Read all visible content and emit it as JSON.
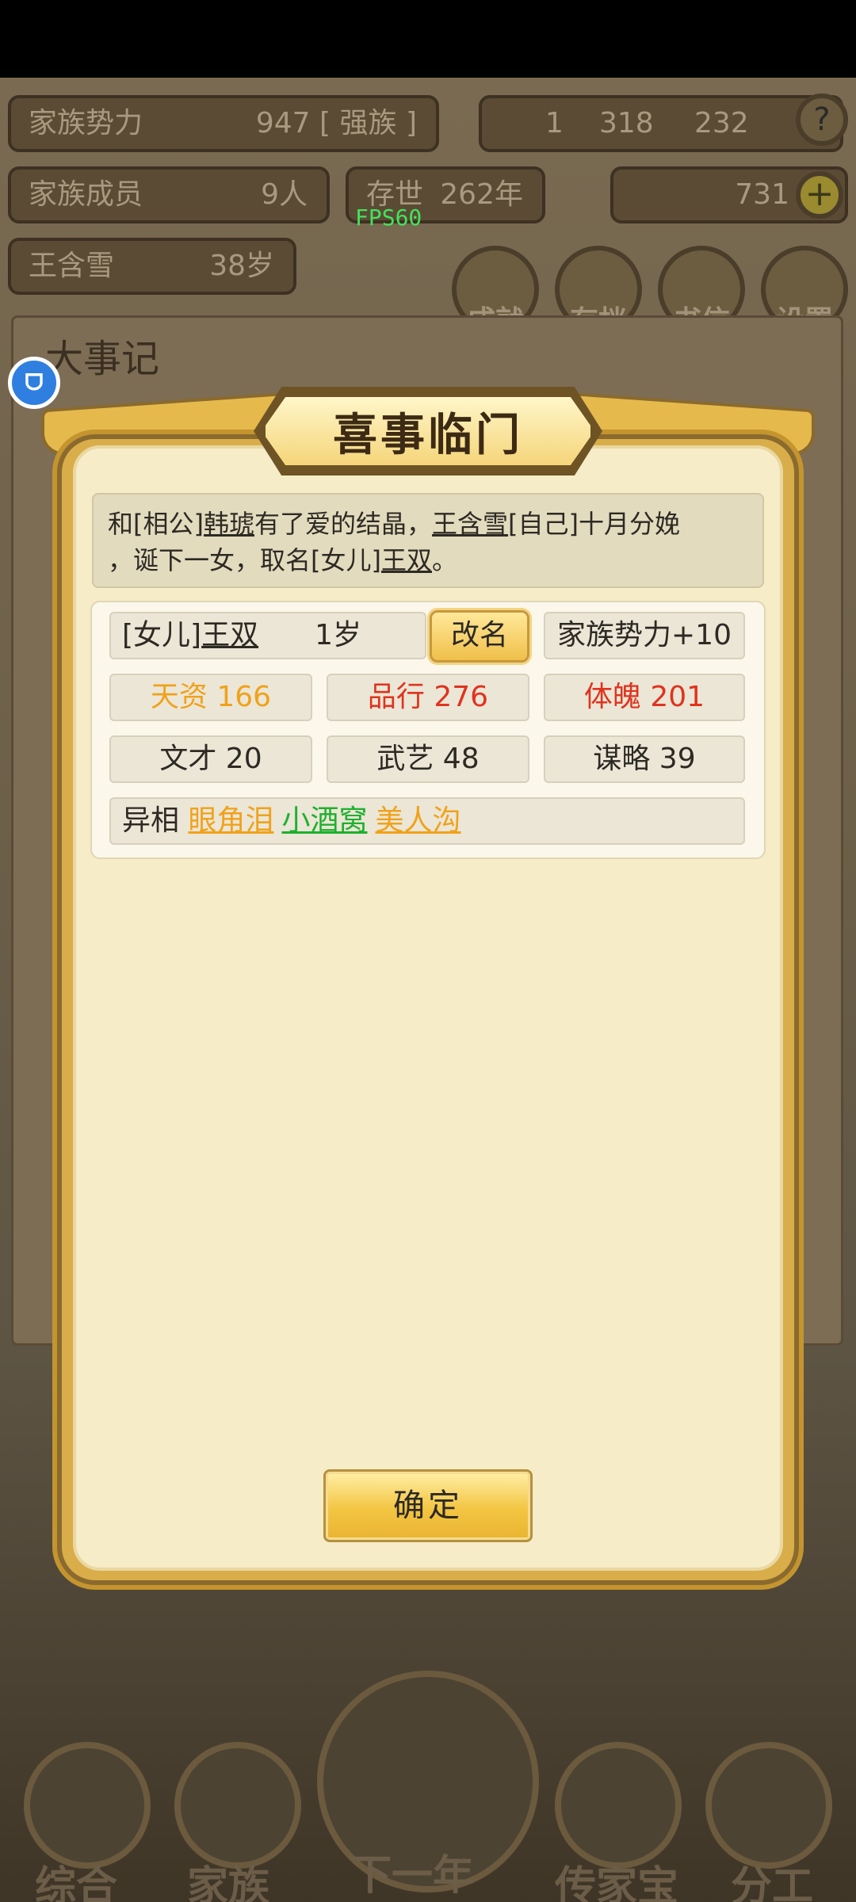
{
  "background": {
    "family_power_label": "家族势力",
    "family_power_value": "947",
    "family_power_suffix": "[ 强族 ]",
    "resources": {
      "gold_bars": "1",
      "silver": "318",
      "coins": "232"
    },
    "help_icon": "?",
    "family_members_label": "家族成员",
    "family_members_value": "9人",
    "era_label": "存世",
    "era_value": "262年",
    "ingots_value": "731",
    "plus_icon": "+",
    "person_name": "王含雪",
    "person_age": "38岁",
    "menu": [
      "成就",
      "存档",
      "书信",
      "设置"
    ],
    "events_title": "大事记",
    "bottom_nav": [
      "综合",
      "家族",
      "下一年",
      "传家宝",
      "分工"
    ]
  },
  "overlay": {
    "fps": "FPS60"
  },
  "modal": {
    "title": "喜事临门",
    "message": {
      "p1": "和[相公]",
      "spouse": "韩琥",
      "p2": "有了爱的结晶，",
      "self": "王含雪",
      "p3": "[自己]十月分娩",
      "p4": "，诞下一女，取名[女儿]",
      "child": "王双",
      "p5": "。"
    },
    "child": {
      "relation": "[女儿]",
      "name": "王双",
      "age": "1岁",
      "rename_label": "改名",
      "family_power_bonus": "家族势力+10"
    },
    "stats": {
      "talent": "天资 166",
      "conduct": "品行 276",
      "physique": "体魄 201",
      "literary": "文才 20",
      "martial": "武艺 48",
      "strategy": "谋略 39"
    },
    "traits": {
      "label": "异相",
      "items": [
        "眼角泪",
        "小酒窝",
        "美人沟"
      ]
    },
    "confirm_label": "确定"
  },
  "colors": {
    "yellow_stat": "#f0a21b",
    "red_stat": "#e0331e",
    "green_trait": "#1eb02e"
  }
}
